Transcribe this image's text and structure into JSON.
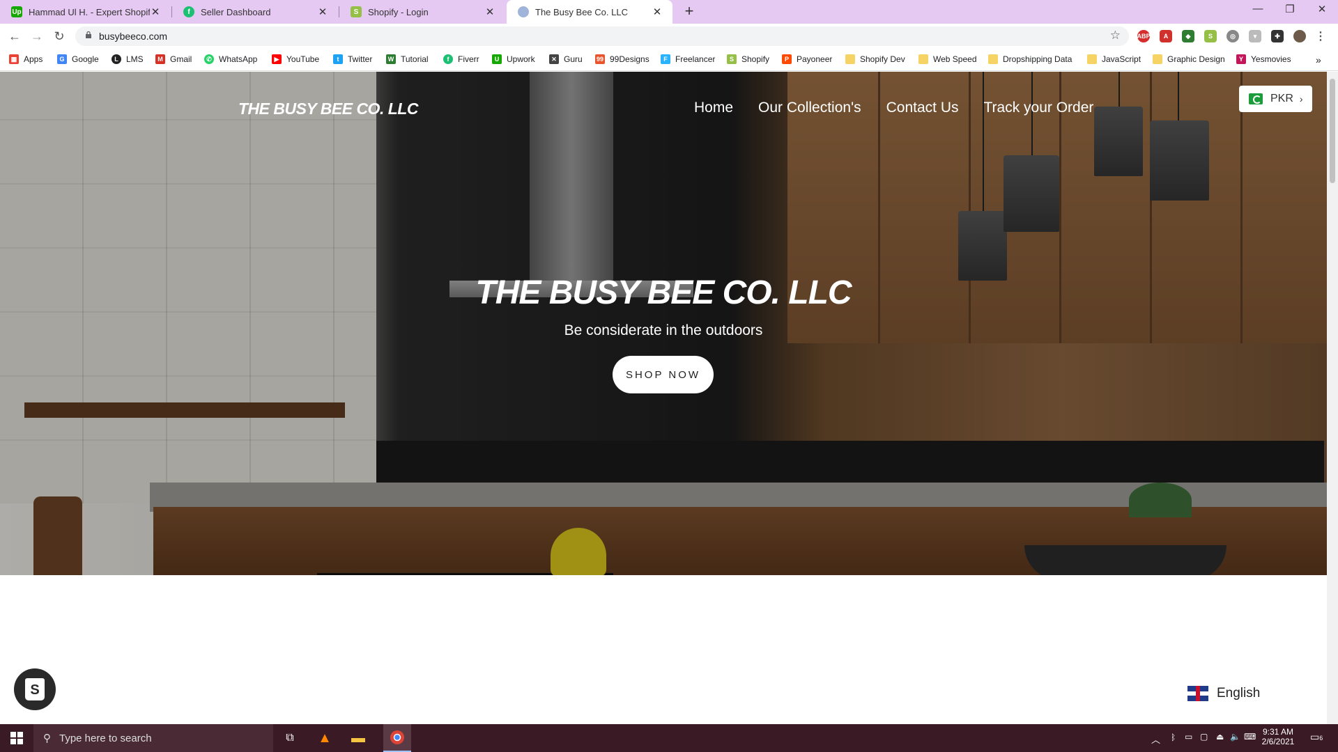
{
  "browser": {
    "tabs": [
      {
        "title": "Hammad Ul H. - Expert Shopify, V",
        "favicon": "upwork-icon",
        "color": "#14a800"
      },
      {
        "title": "Seller Dashboard",
        "favicon": "fiverr-icon",
        "color": "#1dbf73"
      },
      {
        "title": "Shopify - Login",
        "favicon": "shopify-icon",
        "color": "#95bf47"
      },
      {
        "title": "The Busy Bee Co. LLC",
        "favicon": "globe-icon",
        "color": "#9fb4d8"
      }
    ],
    "url": "busybeeco.com",
    "bookmarks": [
      {
        "label": "Apps",
        "color": "#e94235"
      },
      {
        "label": "Google",
        "color": "#4285f4"
      },
      {
        "label": "LMS",
        "color": "#222222"
      },
      {
        "label": "Gmail",
        "color": "#d93025"
      },
      {
        "label": "WhatsApp",
        "color": "#25d366"
      },
      {
        "label": "YouTube",
        "color": "#ff0000"
      },
      {
        "label": "Twitter",
        "color": "#1da1f2"
      },
      {
        "label": "Tutorial",
        "color": "#2e7d32"
      },
      {
        "label": "Fiverr",
        "color": "#1dbf73"
      },
      {
        "label": "Upwork",
        "color": "#14a800"
      },
      {
        "label": "Guru",
        "color": "#444444"
      },
      {
        "label": "99Designs",
        "color": "#e8542b"
      },
      {
        "label": "Freelancer",
        "color": "#29b2fe"
      },
      {
        "label": "Shopify",
        "color": "#95bf47"
      },
      {
        "label": "Payoneer",
        "color": "#ff4800"
      },
      {
        "label": "Shopify Dev",
        "color": "#f6d365"
      },
      {
        "label": "Web Speed",
        "color": "#f6d365"
      },
      {
        "label": "Dropshipping Data",
        "color": "#f6d365"
      },
      {
        "label": "JavaScript",
        "color": "#f6d365"
      },
      {
        "label": "Graphic Design",
        "color": "#f6d365"
      },
      {
        "label": "Yesmovies",
        "color": "#c2185b"
      }
    ]
  },
  "site": {
    "logo": "THE BUSY BEE CO. LLC",
    "nav": [
      "Home",
      "Our Collection's",
      "Contact Us",
      "Track your Order"
    ],
    "currency": "PKR",
    "hero_title": "THE BUSY BEE CO. LLC",
    "hero_subtitle": "Be considerate in the outdoors",
    "cta": "SHOP NOW",
    "language": "English"
  },
  "taskbar": {
    "search_placeholder": "Type here to search",
    "time": "9:31 AM",
    "date": "2/6/2021",
    "notifications": "6"
  }
}
